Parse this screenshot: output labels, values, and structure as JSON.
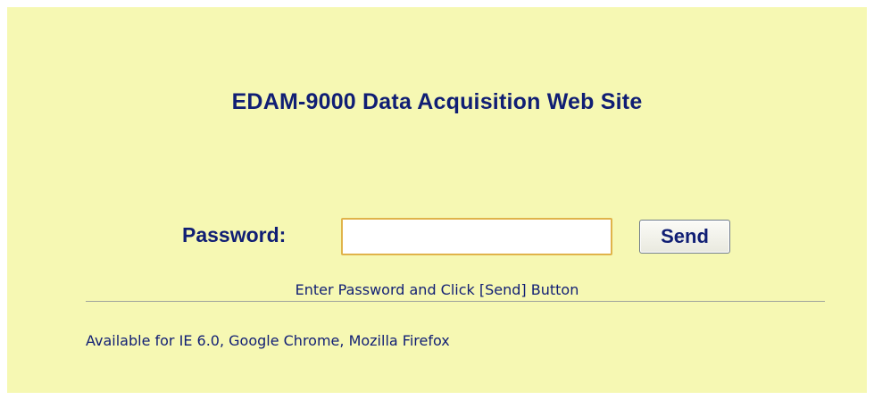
{
  "page": {
    "title": "EDAM-9000 Data Acquisition Web Site",
    "background_color": "#f6f8b3",
    "text_color": "#101e74"
  },
  "login": {
    "password_label": "Password:",
    "password_value": "",
    "send_label": "Send",
    "hint": "Enter Password and Click [Send] Button"
  },
  "footer": {
    "availability": "Available for IE 6.0, Google Chrome, Mozilla Firefox"
  }
}
